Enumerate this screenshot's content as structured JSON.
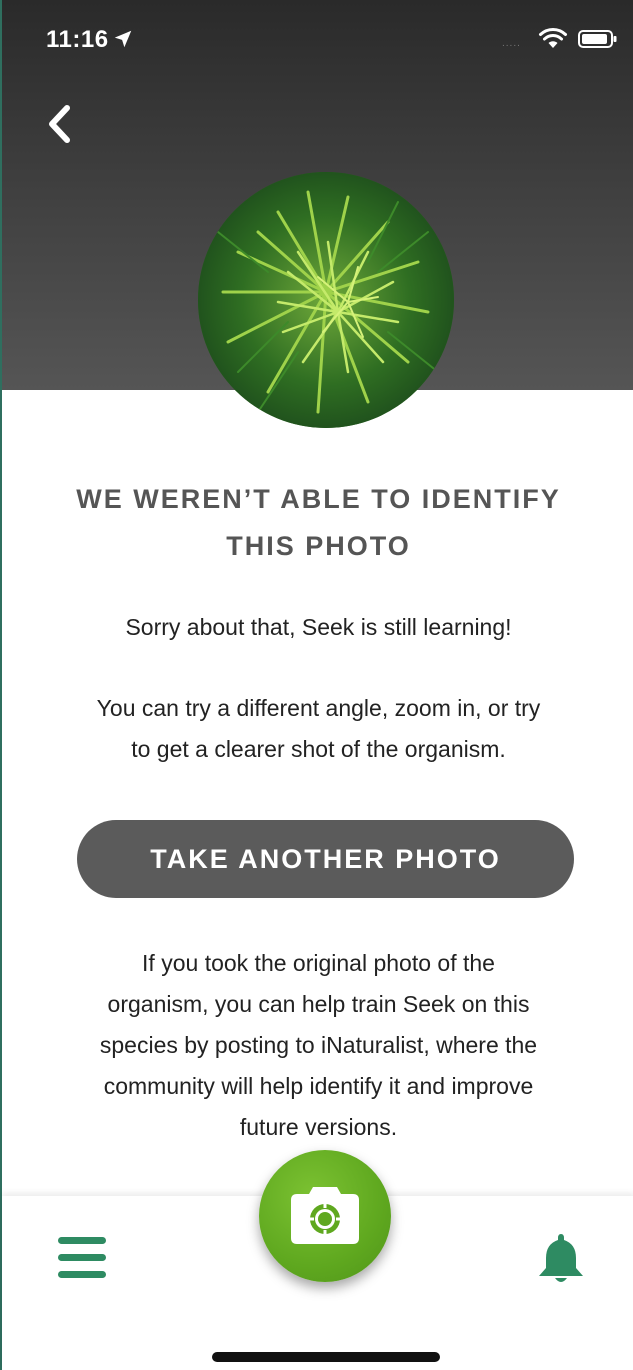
{
  "status_bar": {
    "time": "11:16",
    "signal_dots": "....."
  },
  "header": {
    "back_icon": "chevron-left-icon",
    "photo_alt": "plant photo"
  },
  "main": {
    "title_line1": "WE WEREN’T ABLE TO IDENTIFY",
    "title_line2": "THIS PHOTO",
    "sorry_text": "Sorry about that, Seek is still learning!",
    "tips_line1": "You can try a different angle, zoom in, or try",
    "tips_line2": "to get a clearer shot of the organism.",
    "take_photo_label": "TAKE ANOTHER PHOTO",
    "help_line1": "If you took the original photo of the",
    "help_line2": "organism, you can help train Seek on this",
    "help_line3": "species by posting to iNaturalist, where the",
    "help_line4": "community will help identify it and improve",
    "help_line5": "future versions."
  },
  "nav": {
    "menu_icon": "hamburger-menu-icon",
    "camera_icon": "camera-icon",
    "bell_icon": "bell-icon"
  },
  "colors": {
    "accent_green": "#2e8b62",
    "camera_green": "#5fa81f",
    "button_gray": "#5b5b5b",
    "title_gray": "#555555"
  }
}
